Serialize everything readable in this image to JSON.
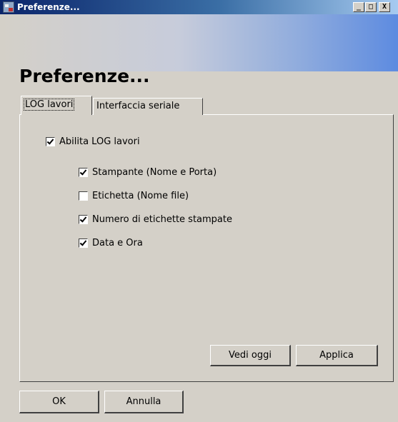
{
  "window": {
    "title": "Preferenze...",
    "icon": "app-icon",
    "minimize_glyph": "_",
    "maximize_glyph": "□",
    "close_glyph": "X"
  },
  "page_title": "Preferenze...",
  "tabs": [
    {
      "label": "LOG lavori",
      "active": true
    },
    {
      "label": "Interfaccia seriale",
      "active": false
    }
  ],
  "log_panel": {
    "enable": {
      "label": "Abilita LOG lavori",
      "checked": true
    },
    "options": [
      {
        "label": "Stampante (Nome e Porta)",
        "checked": true
      },
      {
        "label": "Etichetta (Nome file)",
        "checked": false
      },
      {
        "label": "Numero di etichette stampate",
        "checked": true
      },
      {
        "label": "Data e Ora",
        "checked": true
      }
    ],
    "view_today_label": "Vedi oggi",
    "apply_label": "Applica"
  },
  "footer": {
    "ok_label": "OK",
    "cancel_label": "Annulla"
  },
  "colors": {
    "title_bar_start": "#0a246a",
    "title_bar_end": "#a6caf0",
    "face": "#d4d0c8",
    "header_gradient_end": "#5d8be0"
  }
}
